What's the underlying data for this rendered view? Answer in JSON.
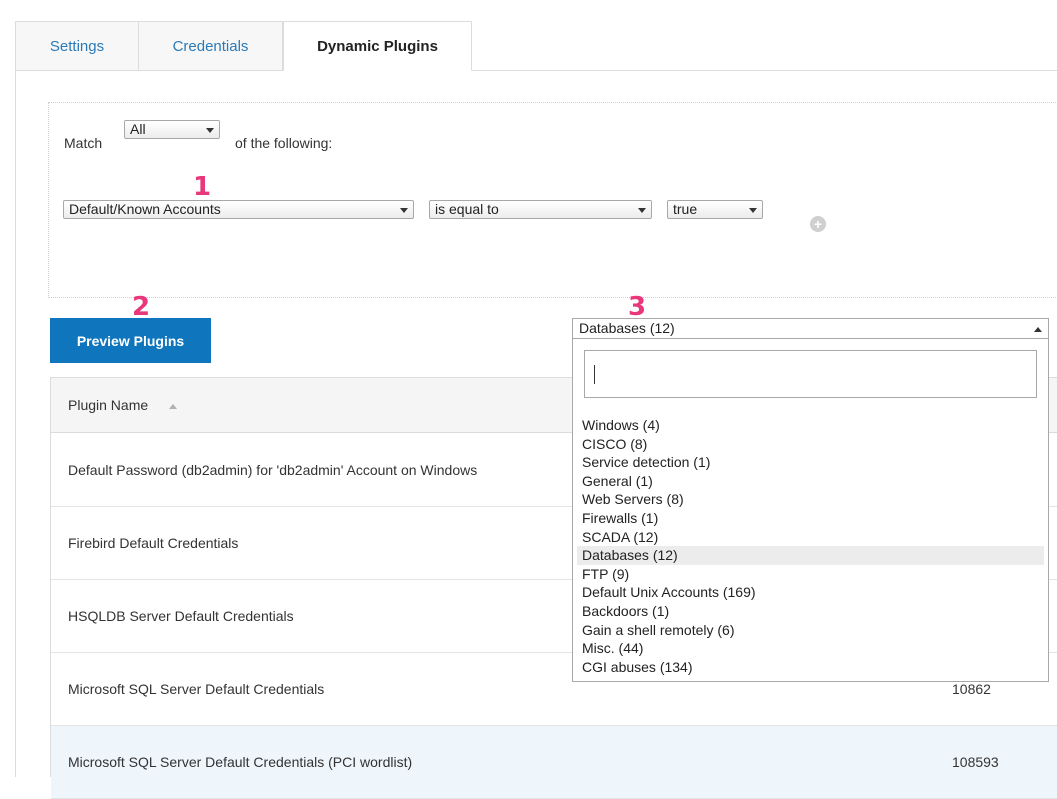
{
  "tabs": [
    {
      "label": "Settings"
    },
    {
      "label": "Credentials"
    },
    {
      "label": "Dynamic Plugins"
    }
  ],
  "filter": {
    "match_label": "Match",
    "match_value": "All",
    "following_label": "of the following:",
    "rule": {
      "field": "Default/Known Accounts",
      "operator": "is equal to",
      "value": "true"
    }
  },
  "markers": [
    "1",
    "2",
    "3"
  ],
  "preview_button": "Preview Plugins",
  "family_select": {
    "selected": "Databases (12)",
    "search_value": "",
    "options": [
      "Windows (4)",
      "CISCO (8)",
      "Service detection (1)",
      "General (1)",
      "Web Servers (8)",
      "Firewalls (1)",
      "SCADA (12)",
      "Databases (12)",
      "FTP (9)",
      "Default Unix Accounts (169)",
      "Backdoors (1)",
      "Gain a shell remotely (6)",
      "Misc. (44)",
      "CGI abuses (134)"
    ],
    "highlighted_index": 7
  },
  "table": {
    "header": "Plugin Name",
    "rows": [
      {
        "name": "Default Password (db2admin) for 'db2admin' Account on Windows",
        "id": ""
      },
      {
        "name": "Firebird Default Credentials",
        "id": ""
      },
      {
        "name": "HSQLDB Server Default Credentials",
        "id": ""
      },
      {
        "name": "Microsoft SQL Server Default Credentials",
        "id": "10862"
      },
      {
        "name": "Microsoft SQL Server Default Credentials (PCI wordlist)",
        "id": "108593"
      }
    ]
  },
  "colors": {
    "accent": "#0f75bc",
    "link": "#2a7ab8",
    "marker": "#e8377a",
    "row_highlight": "#eef5fb"
  },
  "icons": {
    "add_rule": "plus-circle-icon",
    "sort": "sort-ascending-icon"
  }
}
